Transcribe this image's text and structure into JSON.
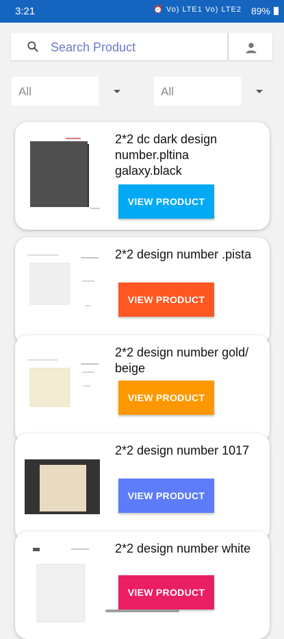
{
  "status_bar": {
    "time": "3:21",
    "indicators": "⏰ Vo) LTE1 Vo) LTE2",
    "battery": "89%"
  },
  "search": {
    "placeholder": "Search Product",
    "value": ""
  },
  "filters": [
    {
      "value": "All"
    },
    {
      "value": "All"
    }
  ],
  "products": [
    {
      "title": "2*2 dc dark design number.pltina galaxy.black",
      "button": "VIEW PRODUCT",
      "button_color": "#03a9f4"
    },
    {
      "title": "2*2 design number .pista",
      "button": "VIEW PRODUCT",
      "button_color": "#ff5722"
    },
    {
      "title": "2*2 design number gold/ beige",
      "button": "VIEW PRODUCT",
      "button_color": "#ff9800"
    },
    {
      "title": "2*2 design number 1017",
      "button": "VIEW PRODUCT",
      "button_color": "#5c7cfa"
    },
    {
      "title": "2*2 design number white",
      "button": "VIEW PRODUCT",
      "button_color": "#e91e63"
    }
  ],
  "colors": {
    "status_bar": "#1565c0",
    "background": "#f2f2f2"
  }
}
